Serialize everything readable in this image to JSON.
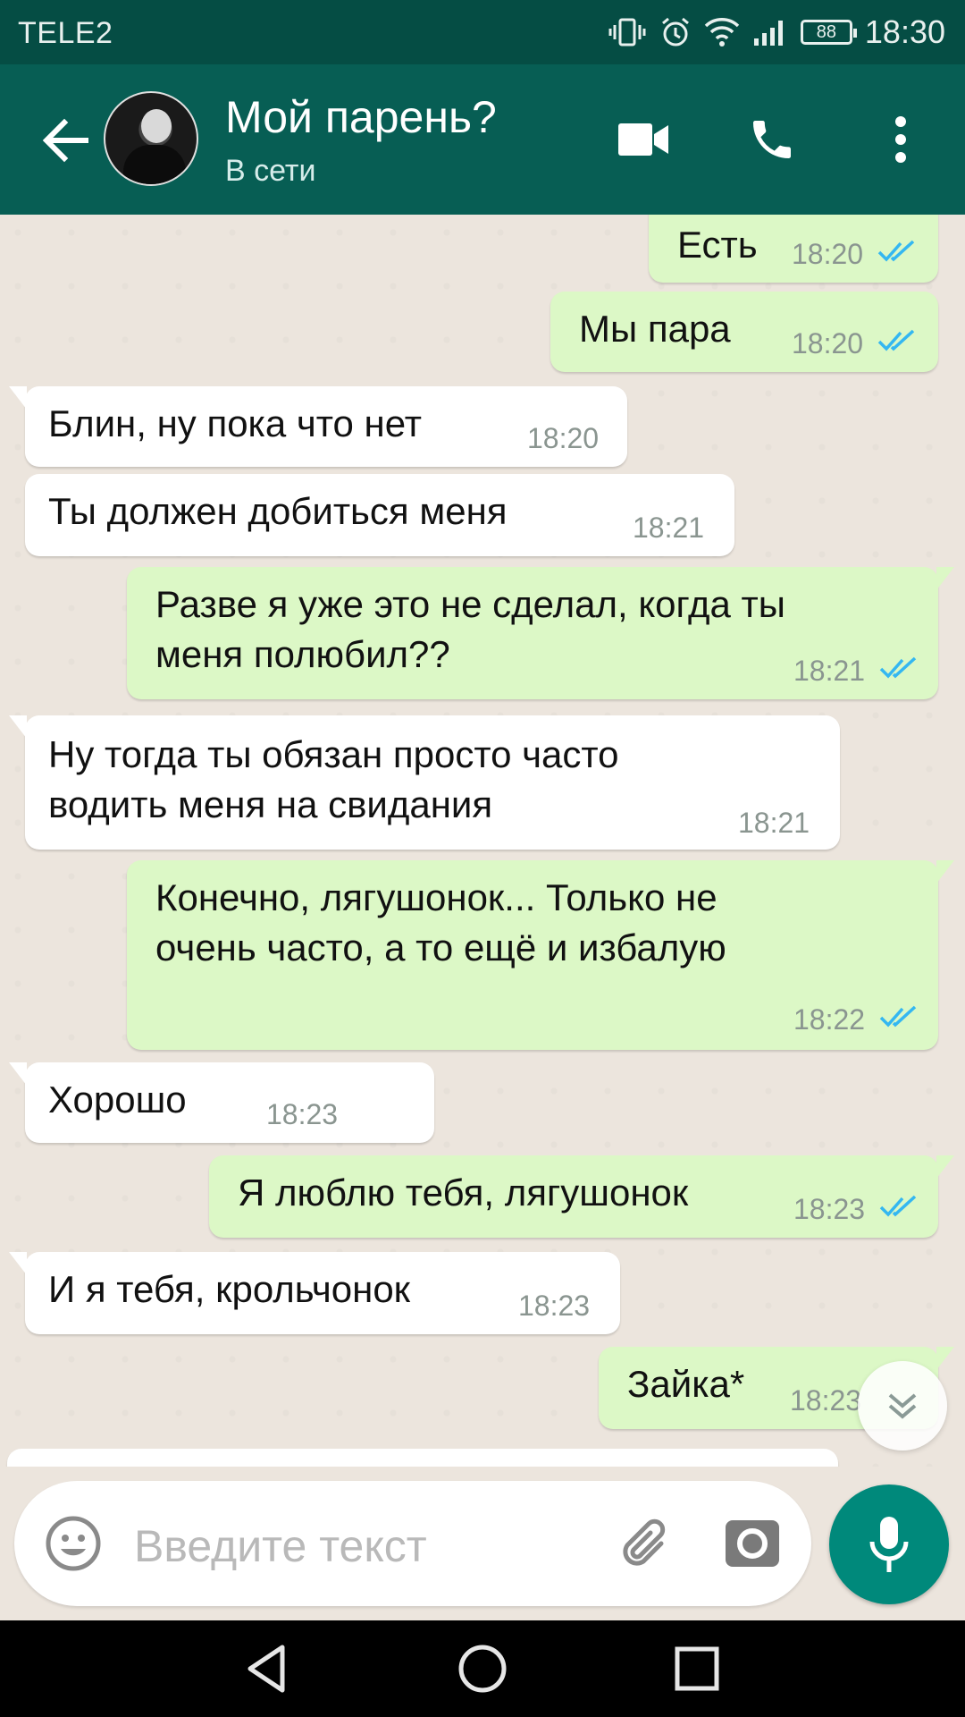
{
  "status_bar": {
    "carrier": "TELE2",
    "battery": "88",
    "time": "18:30"
  },
  "header": {
    "contact_name": "Мой парень?",
    "contact_status": "В сети"
  },
  "messages": [
    {
      "dir": "out",
      "text": "Есть",
      "time": "18:20"
    },
    {
      "dir": "out",
      "text": "Мы пара",
      "time": "18:20"
    },
    {
      "dir": "in",
      "text": "Блин, ну пока что нет",
      "time": "18:20"
    },
    {
      "dir": "in",
      "text": "Ты должен добиться меня",
      "time": "18:21"
    },
    {
      "dir": "out",
      "line1": "Разве я уже это не сделал, когда ты",
      "line2": "меня полюбил??",
      "time": "18:21"
    },
    {
      "dir": "in",
      "line1": "Ну тогда ты обязан просто часто",
      "line2": "водить меня на свидания",
      "time": "18:21"
    },
    {
      "dir": "out",
      "line1": "Конечно, лягушонок...  Только не",
      "line2": "очень часто, а то ещё и избалую",
      "time": "18:22"
    },
    {
      "dir": "in",
      "text": "Хорошо",
      "time": "18:23"
    },
    {
      "dir": "out",
      "text": "Я люблю тебя, лягушонок",
      "time": "18:23"
    },
    {
      "dir": "in",
      "text": "И я тебя, крольчонок",
      "time": "18:23"
    },
    {
      "dir": "out",
      "text": "Зайка*",
      "time": "18:23"
    }
  ],
  "input": {
    "placeholder": "Введите текст"
  },
  "icons": {
    "back": "arrow-left-icon",
    "video": "video-camera-icon",
    "call": "phone-icon",
    "menu": "more-vert-icon",
    "emoji": "emoji-icon",
    "attach": "paperclip-icon",
    "camera": "camera-icon",
    "mic": "microphone-icon",
    "scroll": "chevron-double-down-icon",
    "read": "double-check-icon"
  },
  "colors": {
    "header": "#075e54",
    "status_bar": "#054d44",
    "outgoing": "#dcf8c6",
    "incoming": "#ffffff",
    "ticks": "#34b7f1",
    "accent": "#00897b"
  }
}
